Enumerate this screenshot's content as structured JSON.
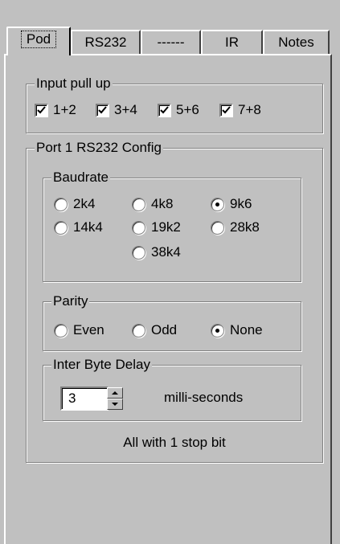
{
  "tabs": [
    {
      "label": "Pod",
      "active": true
    },
    {
      "label": "RS232",
      "active": false
    },
    {
      "label": "------",
      "active": false
    },
    {
      "label": "IR",
      "active": false
    },
    {
      "label": "Notes",
      "active": false
    }
  ],
  "input_pull_up": {
    "title": "Input pull up",
    "items": [
      {
        "label": "1+2",
        "checked": true
      },
      {
        "label": "3+4",
        "checked": true
      },
      {
        "label": "5+6",
        "checked": true
      },
      {
        "label": "7+8",
        "checked": true
      }
    ]
  },
  "port_config": {
    "title": "Port 1 RS232 Config",
    "baudrate": {
      "title": "Baudrate",
      "options": [
        "2k4",
        "4k8",
        "9k6",
        "14k4",
        "19k2",
        "28k8",
        "38k4"
      ],
      "selected": "9k6"
    },
    "parity": {
      "title": "Parity",
      "options": [
        "Even",
        "Odd",
        "None"
      ],
      "selected": "None"
    },
    "inter_byte_delay": {
      "title": "Inter Byte Delay",
      "value": "3",
      "unit": "milli-seconds"
    },
    "footnote": "All with 1 stop bit"
  }
}
